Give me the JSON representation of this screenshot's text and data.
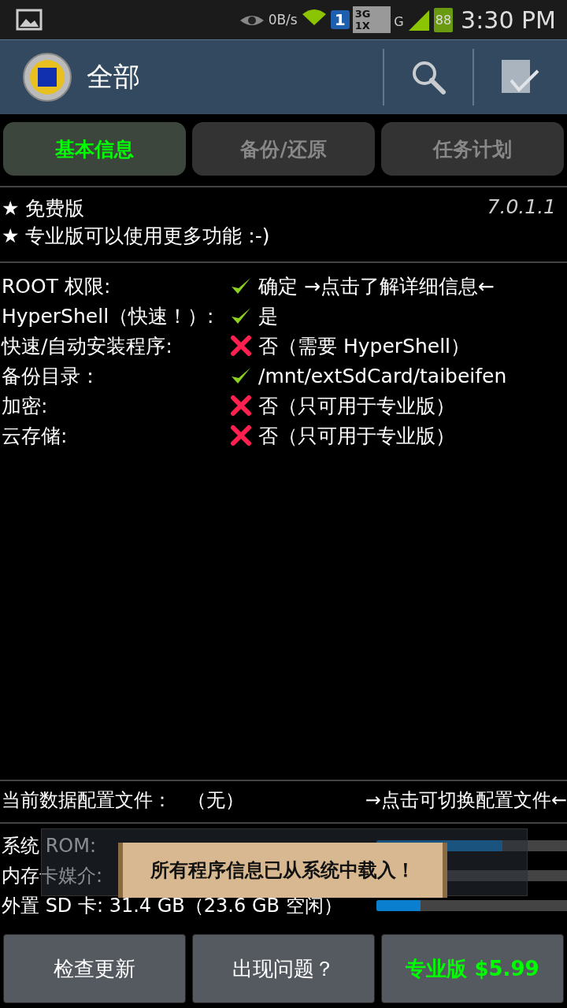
{
  "status_bar": {
    "net_speed": "0B/s",
    "sim": "1",
    "net_type_top": "3G",
    "net_type_bottom": "1X",
    "signal_type": "G",
    "battery": "88",
    "time": "3:30 PM"
  },
  "action_bar": {
    "title": "全部"
  },
  "tabs": [
    {
      "label": "基本信息",
      "selected": true
    },
    {
      "label": "备份/还原",
      "selected": false
    },
    {
      "label": "任务计划",
      "selected": false
    }
  ],
  "version": {
    "edition": "★ 免费版",
    "note": "★ 专业版可以使用更多功能 :-)",
    "number": "7.0.1.1"
  },
  "info_rows": [
    {
      "label": "ROOT 权限:",
      "ok": true,
      "value": "确定 →点击了解详细信息←"
    },
    {
      "label": "HyperShell（快速！）:",
      "ok": true,
      "value": "是"
    },
    {
      "label": "快速/自动安装程序:",
      "ok": false,
      "value": "否（需要 HyperShell）"
    },
    {
      "label": "备份目录：",
      "ok": true,
      "value": "/mnt/extSdCard/taibeifen"
    },
    {
      "label": "加密:",
      "ok": false,
      "value": "否（只可用于专业版）"
    },
    {
      "label": "云存储:",
      "ok": false,
      "value": "否（只可用于专业版）"
    }
  ],
  "profile": {
    "label": "当前数据配置文件：",
    "value": "（无）",
    "action": "→点击可切换配置文件←"
  },
  "storage": [
    {
      "label": "系统 ROM:",
      "level": 0.66
    },
    {
      "label": "内存卡媒介:"
    },
    {
      "label": "外置 SD 卡: 31.4 GB（23.6 GB 空闲）",
      "level": 0.23
    }
  ],
  "toast": {
    "message": "所有程序信息已从系统中载入！"
  },
  "buttons": [
    {
      "label": "检查更新",
      "kind": "plain"
    },
    {
      "label": "出现问题？",
      "kind": "plain"
    },
    {
      "label": "专业版 $5.99",
      "kind": "promo"
    }
  ]
}
